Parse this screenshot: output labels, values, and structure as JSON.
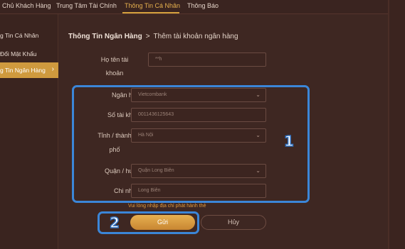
{
  "topnav": {
    "items": [
      {
        "label": "Chủ Khách Hàng"
      },
      {
        "label": "Trung Tâm Tài Chính"
      },
      {
        "label": "Thông Tin Cá Nhân"
      },
      {
        "label": "Thông Báo"
      }
    ]
  },
  "sidebar": {
    "items": [
      {
        "label": "g Tin Cá Nhân"
      },
      {
        "label": "Đổi Mật Khẩu"
      },
      {
        "label": "g Tin Ngân Hàng"
      }
    ]
  },
  "breadcrumb": {
    "parent": "Thông Tin Ngân Hàng",
    "separator": ">",
    "current": "Thêm tài khoản ngân hàng"
  },
  "form": {
    "fullname_label_1": "Họ tên tài",
    "fullname_label_2": "khoản",
    "fullname_value": "**h",
    "bank_label": "Ngân hàng",
    "bank_value": "Vietcombank",
    "account_label": "Số tài khoản",
    "account_value": "0011436125643",
    "province_label_1": "Tỉnh / thành",
    "province_label_2": "phố",
    "province_value": "Hà Nội",
    "district_label": "Quận / huyện",
    "district_value": "Quận Long Biên",
    "branch_label": "Chi nhánh",
    "branch_value": "Long Biên",
    "helper_text": "Vui lòng nhập địa chỉ phát hành thẻ",
    "submit_label": "Gửi",
    "cancel_label": "Hủy"
  },
  "annotations": {
    "badge1": "1",
    "badge2": "2"
  },
  "icons": {
    "dropdown": "chevron-down-icon",
    "sidebar_arrow": "chevron-right-icon"
  },
  "colors": {
    "accent": "#d6a13d",
    "highlight": "#3b86d8",
    "background": "#3e2722"
  }
}
